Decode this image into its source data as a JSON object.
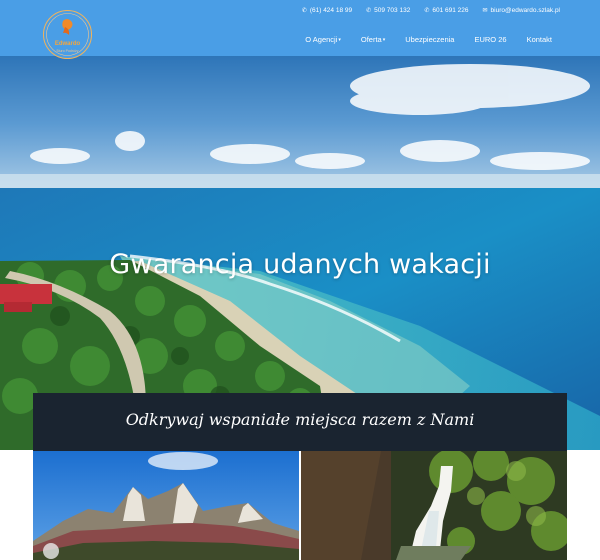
{
  "header": {
    "logo": {
      "text": "Edwardo",
      "subtitle": "Biuro Podróży"
    },
    "contacts": [
      {
        "icon": "phone-icon",
        "text": "(61) 424 18 99"
      },
      {
        "icon": "phone-icon",
        "text": "509 703 132"
      },
      {
        "icon": "phone-icon",
        "text": "601 691 226"
      },
      {
        "icon": "envelope-icon",
        "text": "biuro@edwardo.szlak.pl"
      }
    ],
    "nav": [
      {
        "label": "O Agencji",
        "dropdown": true
      },
      {
        "label": "Oferta",
        "dropdown": true
      },
      {
        "label": "Ubezpieczenia",
        "dropdown": false
      },
      {
        "label": "EURO 26",
        "dropdown": false
      },
      {
        "label": "Kontakt",
        "dropdown": false
      }
    ]
  },
  "hero": {
    "title": "Gwarancja udanych wakacji"
  },
  "banner": {
    "text": "Odkrywaj wspaniałe miejsca razem z Nami"
  },
  "colors": {
    "header_bg": "#4a9ee6",
    "banner_bg": "#1a2430",
    "logo_accent": "#f3a63e"
  }
}
